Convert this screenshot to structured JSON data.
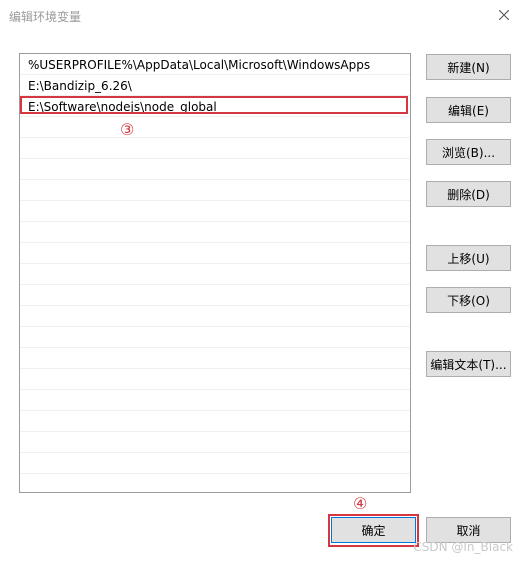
{
  "window": {
    "title": "编辑环境变量"
  },
  "path_list": {
    "entries": [
      "%USERPROFILE%\\AppData\\Local\\Microsoft\\WindowsApps",
      "E:\\Bandizip_6.26\\",
      "E:\\Software\\nodejs\\node_global",
      "",
      "",
      "",
      "",
      "",
      "",
      "",
      "",
      "",
      "",
      "",
      "",
      "",
      "",
      "",
      "",
      "",
      "",
      ""
    ]
  },
  "buttons": {
    "new": "新建(N)",
    "edit": "编辑(E)",
    "browse": "浏览(B)...",
    "delete": "删除(D)",
    "move_up": "上移(U)",
    "move_down": "下移(O)",
    "edit_text": "编辑文本(T)...",
    "ok": "确定",
    "cancel": "取消"
  },
  "annotations": {
    "step3": "③",
    "step4": "④"
  },
  "watermark": "CSDN @In_Black",
  "colors": {
    "annotation_red": "#d4373f",
    "button_face": "#e1e1e1",
    "default_button_border": "#0078d7"
  }
}
